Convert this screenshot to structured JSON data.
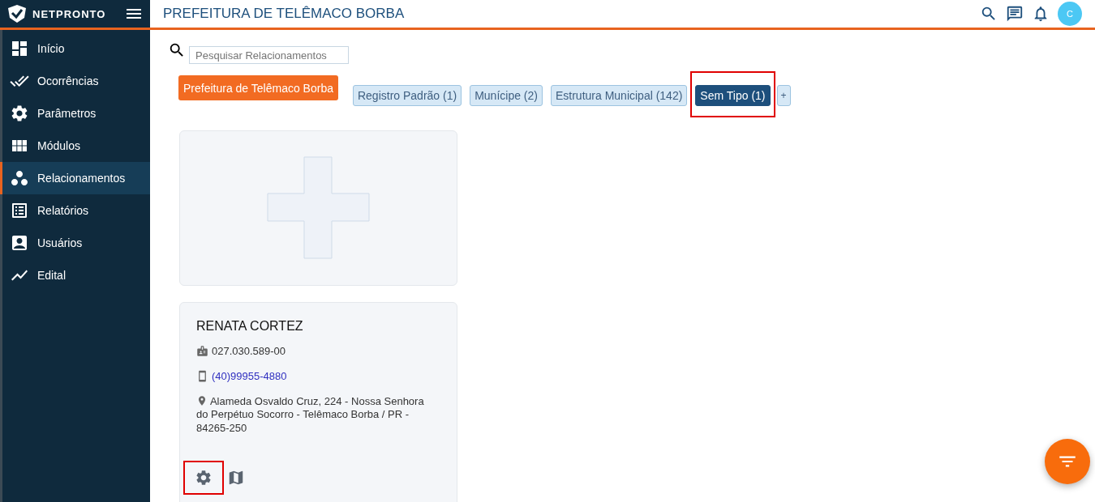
{
  "header": {
    "logo": "NETPRONTO",
    "title": "PREFEITURA DE TELÊMACO BORBA",
    "avatar": "C"
  },
  "sidebar": {
    "items": [
      {
        "label": "Início",
        "selected": false
      },
      {
        "label": "Ocorrências",
        "selected": false
      },
      {
        "label": "Parâmetros",
        "selected": false
      },
      {
        "label": "Módulos",
        "selected": false
      },
      {
        "label": "Relacionamentos",
        "selected": true
      },
      {
        "label": "Relatórios",
        "selected": false
      },
      {
        "label": "Usuários",
        "selected": false
      },
      {
        "label": "Edital",
        "selected": false
      }
    ]
  },
  "search": {
    "placeholder": "Pesquisar Relacionamentos"
  },
  "organization_button": "Prefeitura de Telêmaco Borba",
  "type_tabs": [
    {
      "label": "Registro Padrão (1)",
      "selected": false,
      "highlighted": false
    },
    {
      "label": "Munícipe (2)",
      "selected": false,
      "highlighted": false
    },
    {
      "label": "Estrutura Municipal (142)",
      "selected": false,
      "highlighted": false
    },
    {
      "label": "Sem Tipo (1)",
      "selected": true,
      "highlighted": true
    }
  ],
  "add_tab": "+",
  "person_card": {
    "name": "RENATA CORTEZ",
    "document": "027.030.589-00",
    "phone": "(40)99955-4880",
    "address": "Alameda Osvaldo Cruz, 224 - Nossa Senhora do Perpétuo Socorro - Telêmaco Borba / PR - 84265-250",
    "settings_highlighted": true
  }
}
